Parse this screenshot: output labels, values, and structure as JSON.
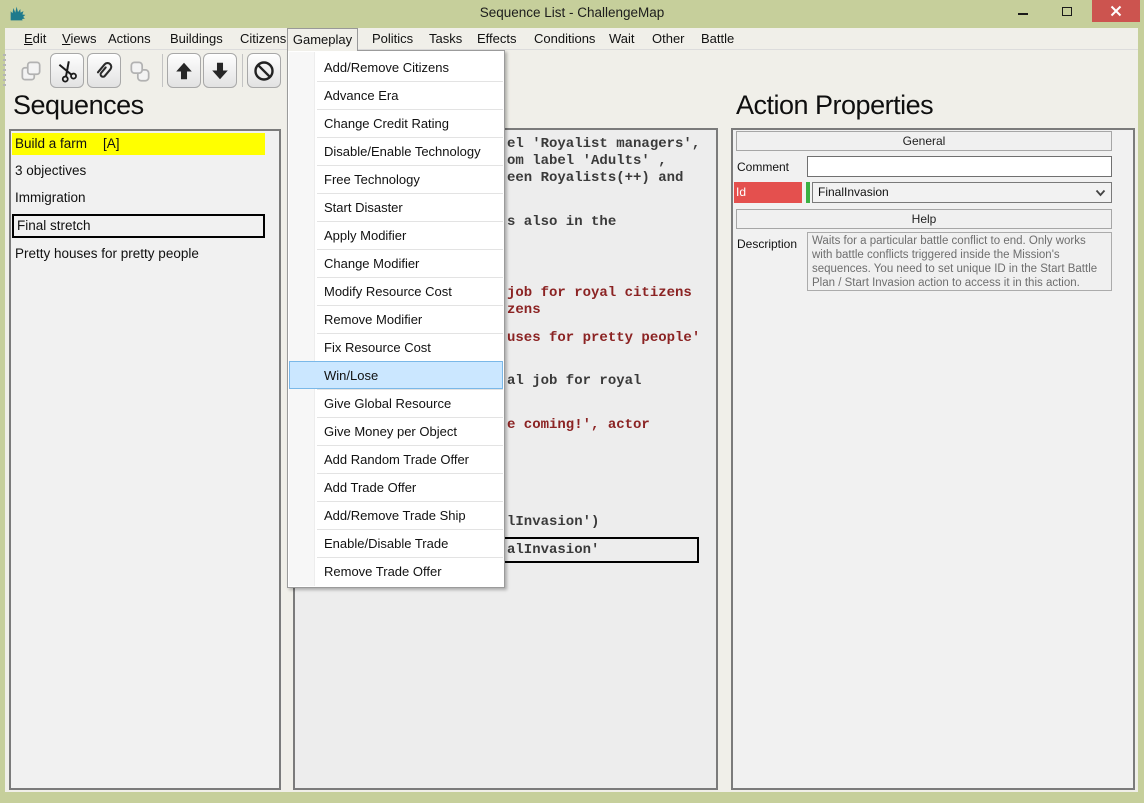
{
  "titlebar": {
    "title": "Sequence List - ChallengeMap",
    "icons": [
      "app-icon",
      "minimize-icon",
      "maximize-icon",
      "close-icon"
    ]
  },
  "menubar": {
    "items": [
      "Edit",
      "Views",
      "Actions",
      "Buildings",
      "Citizens",
      "Gameplay",
      "Politics",
      "Tasks",
      "Effects",
      "Conditions",
      "Wait",
      "Other",
      "Battle"
    ],
    "open_menu": "Gameplay"
  },
  "toolbar": {
    "icons": [
      {
        "name": "copy-icon",
        "disabled": true
      },
      {
        "name": "cut-icon",
        "disabled": false
      },
      {
        "name": "paperclip-icon",
        "disabled": false
      },
      {
        "name": "copy-pages-icon",
        "disabled": true
      },
      {
        "name": "move-up-icon",
        "disabled": false
      },
      {
        "name": "move-down-icon",
        "disabled": false
      },
      {
        "name": "block-icon",
        "disabled": false
      }
    ]
  },
  "sequences": {
    "heading": "Sequences",
    "items": [
      {
        "label": "Build a farm",
        "badge": "[A]",
        "state": "selected-yellow"
      },
      {
        "label": "3 objectives",
        "state": "normal"
      },
      {
        "label": "Immigration",
        "state": "normal"
      },
      {
        "label": "Final stretch",
        "state": "outlined"
      },
      {
        "label": "Pretty houses for pretty people",
        "state": "normal"
      }
    ]
  },
  "gameplay_menu": {
    "items": [
      "Add/Remove Citizens",
      "Advance Era",
      "Change Credit Rating",
      "Disable/Enable Technology",
      "Free Technology",
      "Start Disaster",
      "Apply Modifier",
      "Change Modifier",
      "Modify Resource Cost",
      "Remove Modifier",
      "Fix Resource Cost",
      "Win/Lose",
      "Give Global Resource",
      "Give Money per Object",
      "Add Random Trade Offer",
      "Add Trade Offer",
      "Add/Remove Trade Ship",
      "Enable/Disable Trade",
      "Remove Trade Offer"
    ],
    "highlighted_item": "Win/Lose"
  },
  "actions_editor": {
    "visible_line_fragments": [
      {
        "text": "el 'Royalist managers',",
        "tone": "dark"
      },
      {
        "text": "om label 'Adults' ,",
        "tone": "dark"
      },
      {
        "text": "een Royalists(++) and",
        "tone": "dark"
      },
      {
        "text": "s also in the",
        "tone": "dark"
      },
      {
        "text": "job for royal citizens",
        "tone": "maroon"
      },
      {
        "text": "zens",
        "tone": "maroon"
      },
      {
        "text": "uses for pretty people'",
        "tone": "maroon"
      },
      {
        "text": "al job for royal",
        "tone": "dark"
      },
      {
        "text": "e coming!', actor",
        "tone": "maroon"
      },
      {
        "text": "lInvasion')",
        "tone": "dark"
      },
      {
        "text": "alInvasion'",
        "tone": "dark",
        "boxed": true
      }
    ]
  },
  "action_properties": {
    "heading": "Action Properties",
    "general_header": "General",
    "help_header": "Help",
    "comment_label": "Comment",
    "comment_value": "",
    "id_label": "Id",
    "id_value": "FinalInvasion",
    "description_label": "Description",
    "description": "Waits for a particular battle conflict to end. Only works with battle conflicts triggered inside the Mission's sequences. You need to set unique ID in the Start Battle Plan / Start Invasion action to access it in this action."
  },
  "colors": {
    "titlebar_green": "#c6cf9b",
    "close_red": "#cc544f",
    "selection_yellow": "#ffff00",
    "menu_highlight_blue": "#cbe7ff",
    "id_required_red": "#e4504e",
    "id_valid_green": "#3bb143",
    "maroon_text": "#8b2323"
  }
}
